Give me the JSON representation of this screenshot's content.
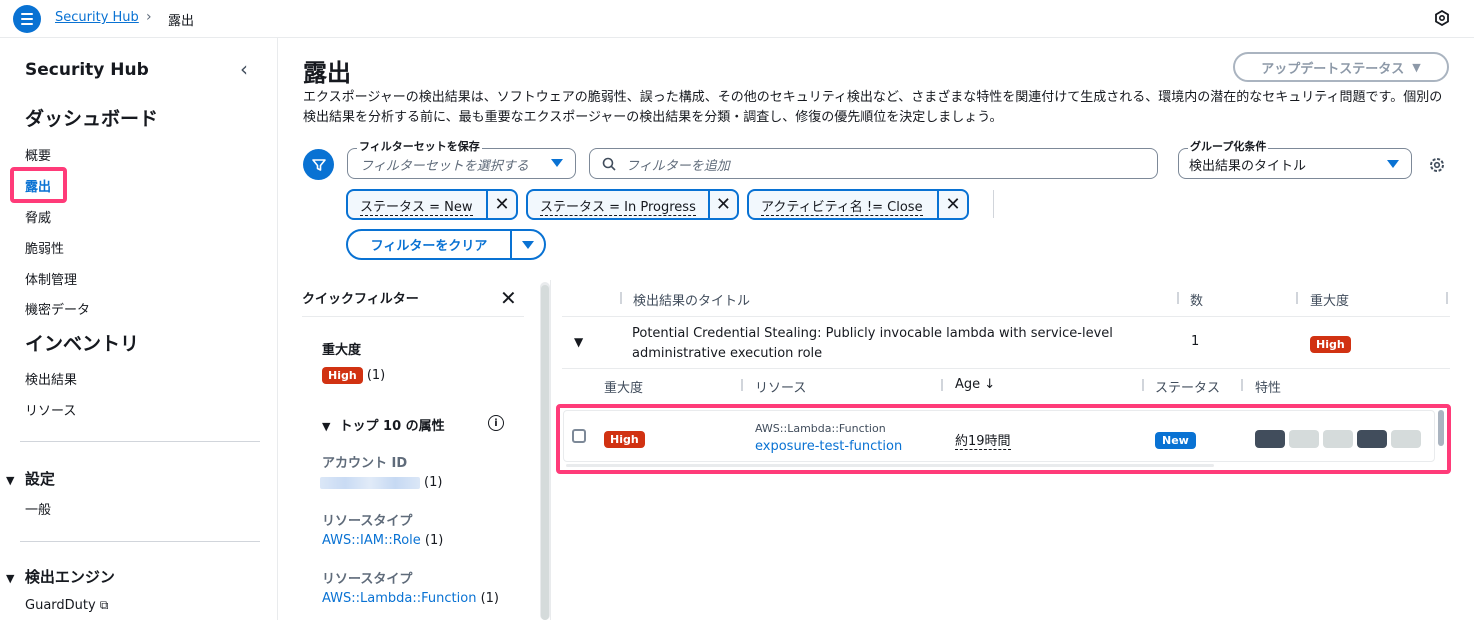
{
  "topbar": {
    "breadcrumb_root": "Security Hub",
    "breadcrumb_current": "露出"
  },
  "sidebar": {
    "title": "Security Hub",
    "dashboard": "ダッシュボード",
    "items": [
      "概要",
      "露出",
      "脅威",
      "脆弱性",
      "体制管理",
      "機密データ"
    ],
    "inventory": "インベントリ",
    "inventory_items": [
      "検出結果",
      "リソース"
    ],
    "settings_section": "設定",
    "settings_items": [
      "一般"
    ],
    "engines_section": "検出エンジン",
    "engines_items": [
      "GuardDuty"
    ]
  },
  "main": {
    "title": "露出",
    "description": "エクスポージャーの検出結果は、ソフトウェアの脆弱性、誤った構成、その他のセキュリティ検出など、さまざまな特性を関連付けて生成される、環境内の潜在的なセキュリティ問題です。個別の検出結果を分析する前に、最も重要なエクスポージャーの検出結果を分類・調査し、修復の優先順位を決定しましょう。",
    "update_status": "アップデートステータス"
  },
  "filters": {
    "save_label": "フィルターセットを保存",
    "save_placeholder": "フィルターセットを選択する",
    "search_placeholder": "フィルターを追加",
    "group_label": "グループ化条件",
    "group_value": "検出結果のタイトル",
    "tokens": [
      "ステータス = New",
      "ステータス = In Progress",
      "アクティビティ名 != Close"
    ],
    "clear": "フィルターをクリア"
  },
  "quick_filters": {
    "title": "クイックフィルター",
    "severity_label": "重大度",
    "severity_badge": "High",
    "severity_count": "(1)",
    "top10": "トップ 10 の属性",
    "account_label": "アカウント ID",
    "account_count": "(1)",
    "rt1_label": "リソースタイプ",
    "rt1_value": "AWS::IAM::Role",
    "rt1_count": "(1)",
    "rt2_label": "リソースタイプ",
    "rt2_value": "AWS::Lambda::Function",
    "rt2_count": "(1)"
  },
  "table": {
    "headers": {
      "title": "検出結果のタイトル",
      "count": "数",
      "severity": "重大度"
    },
    "group_row": {
      "title_line1": "Potential Credential Stealing: Publicly invocable lambda with service-level",
      "title_line2": "administrative execution role",
      "count": "1",
      "severity": "High"
    },
    "sub_headers": {
      "severity": "重大度",
      "resource": "リソース",
      "age": "Age",
      "status": "ステータス",
      "traits": "特性"
    },
    "row": {
      "severity": "High",
      "resource_type": "AWS::Lambda::Function",
      "resource_name": "exposure-test-function",
      "age": "約19時間",
      "status": "New"
    }
  },
  "colors": {
    "accent": "#0972d3",
    "high": "#d13212",
    "highlight": "#ff3b79"
  }
}
